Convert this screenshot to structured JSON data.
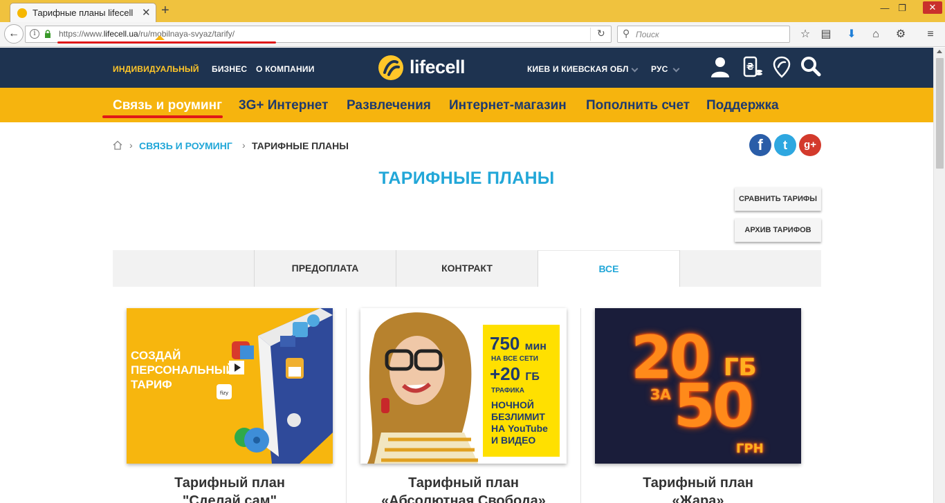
{
  "browser": {
    "tab_title": "Тарифные планы lifecell",
    "url_prefix": "https://www.",
    "url_domain": "lifecell.ua",
    "url_path": "/ru/mobilnaya-svyaz/tarify/",
    "search_placeholder": "Поиск",
    "accent_underline_color": "#e01818"
  },
  "header": {
    "nav": [
      "ИНДИВИДУАЛЬНЫЙ",
      "БИЗНЕС",
      "О КОМПАНИИ"
    ],
    "logo_text": "lifecell",
    "region": "КИЕВ И КИЕВСКАЯ ОБЛ",
    "language": "РУС",
    "icons": [
      "user-icon",
      "balance-icon",
      "location-icon",
      "search-icon"
    ],
    "bg_color": "#1e3350",
    "active_color": "#ffc629"
  },
  "catnav": {
    "items": [
      "Связь и роуминг",
      "3G+ Интернет",
      "Развлечения",
      "Интернет-магазин",
      "Пополнить счет",
      "Поддержка"
    ],
    "bg_color": "#f6b40e"
  },
  "breadcrumb": {
    "section": "СВЯЗЬ И РОУМИНГ",
    "current": "ТАРИФНЫЕ ПЛАНЫ"
  },
  "social": {
    "facebook": "f",
    "twitter": "t",
    "googleplus": "g+"
  },
  "page": {
    "title": "ТАРИФНЫЕ ПЛАНЫ",
    "compare_button": "СРАВНИТЬ ТАРИФЫ",
    "archive_button": "АРХИВ ТАРИФОВ",
    "title_color": "#22a7d8"
  },
  "filter_tabs": [
    "ПРЕДОПЛАТА",
    "КОНТРАКТ",
    "ВСЕ"
  ],
  "cards": [
    {
      "banner_lines": [
        "СОЗДАЙ",
        "ПЕРСОНАЛЬНЫЙ",
        "ТАРИФ"
      ],
      "title_line1": "Тарифный план",
      "title_line2": "\"Сделай сам\""
    },
    {
      "banner_minutes": "750",
      "banner_minutes_unit": "мин",
      "banner_all_networks": "НА ВСЕ СЕТИ",
      "banner_gb": "+20",
      "banner_gb_unit": "ГБ",
      "banner_traffic": "ТРАФИКА",
      "banner_night": [
        "НОЧНОЙ",
        "БЕЗЛИМИТ",
        "НА YouTube",
        "И ВИДЕО"
      ],
      "title_line1": "Тарифный план",
      "title_line2": "«Абсолютная Свобода»"
    },
    {
      "banner_gb_value": "20",
      "banner_gb_unit": "ГБ",
      "banner_for": "ЗА",
      "banner_price": "50",
      "banner_currency": "ГРН",
      "title_line1": "Тарифный план",
      "title_line2": "«Жара»"
    }
  ]
}
